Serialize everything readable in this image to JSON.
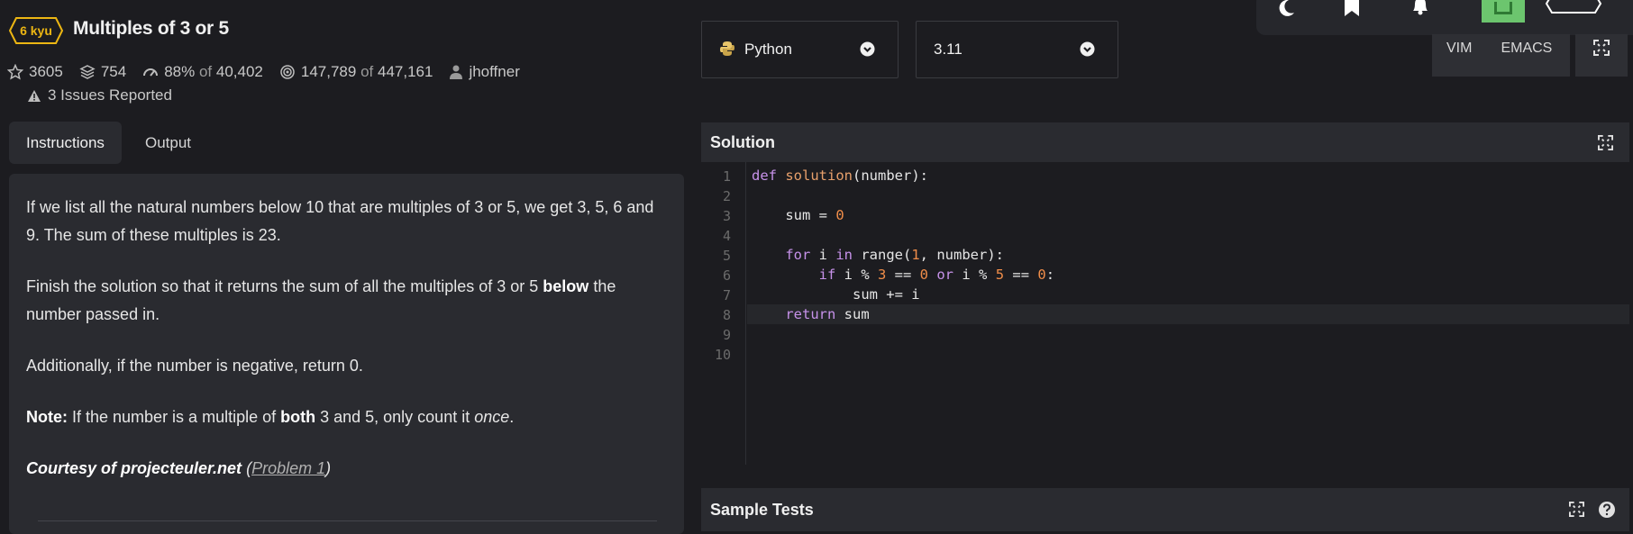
{
  "kata": {
    "rank": "6 kyu",
    "title": "Multiples of 3 or 5",
    "stars": "3605",
    "collections": "754",
    "satisfaction": "88%",
    "satisfaction_of": "of",
    "votes": "40,402",
    "completions": "147,789",
    "completions_of": "of",
    "attempts": "447,161",
    "author": "jhoffner",
    "issues": "3 Issues Reported"
  },
  "tabs": {
    "instructions": "Instructions",
    "output": "Output"
  },
  "description": {
    "p1": "If we list all the natural numbers below 10 that are multiples of 3 or 5, we get 3, 5, 6 and 9. The sum of these multiples is 23.",
    "p2_a": "Finish the solution so that it returns the sum of all the multiples of 3 or 5 ",
    "p2_b": "below",
    "p2_c": " the number passed in.",
    "p3": "Additionally, if the number is negative, return 0.",
    "p4_a": "Note:",
    "p4_b": " If the number is a multiple of ",
    "p4_c": "both",
    "p4_d": " 3 and 5, only count it ",
    "p4_e": "once",
    "p4_f": ".",
    "p5_a": "Courtesy of projecteuler.net",
    "p5_b": " (",
    "p5_link": "Problem 1",
    "p5_c": ")"
  },
  "editor_controls": {
    "language": "Python",
    "version": "3.11",
    "vim": "VIM",
    "emacs": "EMACS"
  },
  "solution": {
    "header": "Solution",
    "line_numbers": [
      "1",
      "2",
      "3",
      "4",
      "5",
      "6",
      "7",
      "8",
      "9",
      "10"
    ],
    "code": {
      "l1_kw": "def",
      "l1_fn": "solution",
      "l1_rest": "(number):",
      "l3_a": "    sum = ",
      "l3_num": "0",
      "l5_kw": "    for",
      "l5_b": " i ",
      "l5_in": "in",
      "l5_c": " range(",
      "l5_num": "1",
      "l5_d": ", number):",
      "l6_kw": "        if",
      "l6_b": " i % ",
      "l6_n1": "3",
      "l6_c": " == ",
      "l6_n2": "0",
      "l6_or": " or",
      "l6_d": " i % ",
      "l6_n3": "5",
      "l6_e": " == ",
      "l6_n4": "0",
      "l6_f": ":",
      "l7": "            sum += i",
      "l8_kw": "    return",
      "l8_b": " sum"
    }
  },
  "sample_tests": {
    "header": "Sample Tests"
  },
  "colors": {
    "accent_kyu": "#ecb613",
    "background": "#1c1c20",
    "panel": "#2a2b30"
  },
  "icons": [
    "star-icon",
    "collections-icon",
    "satisfaction-icon",
    "completions-icon",
    "author-icon",
    "warning-icon",
    "python-icon",
    "chevron-down-icon",
    "fullscreen-icon",
    "help-icon",
    "moon-icon",
    "bookmark-icon",
    "bell-icon",
    "avatar-icon",
    "rank-badge-icon"
  ]
}
